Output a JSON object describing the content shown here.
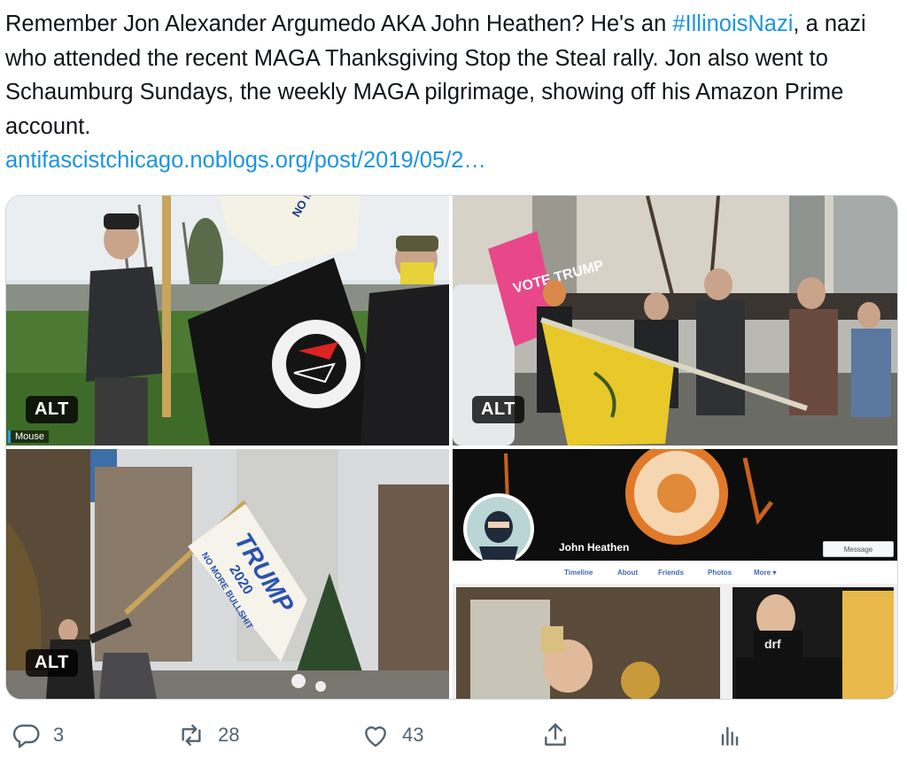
{
  "tweet": {
    "text_part1": "Remember Jon Alexander Argumedo AKA John Heathen? He's an ",
    "hashtag": "#IllinoisNazi",
    "text_part2": ", a nazi who attended the recent MAGA Thanksgiving Stop the Steal rally. Jon also went to Schaumburg Sundays, the weekly MAGA pilgrimage, showing off his Amazon Prime account.",
    "link": "antifascistchicago.noblogs.org/post/2019/05/2…"
  },
  "media": {
    "alt_label": "ALT",
    "photo1_caption": "Mouse",
    "photo1_flag_text": "NO MORE BULLSHIT",
    "photo2_sign_text": "VOTE TRUMP",
    "photo3_flag": {
      "line1": "TRUMP",
      "line2": "2020",
      "line3": "NO MORE BULLSHIT"
    },
    "profile": {
      "name": "John Heathen",
      "message_button": "Message",
      "tabs": [
        "Timeline",
        "About",
        "Friends",
        "Photos",
        "More ▾"
      ]
    }
  },
  "actions": {
    "reply_count": "3",
    "retweet_count": "28",
    "like_count": "43"
  },
  "colors": {
    "link": "#1b95e0",
    "icon": "#536471",
    "text": "#0f1419"
  },
  "icons": [
    "reply-icon",
    "retweet-icon",
    "like-icon",
    "share-icon",
    "analytics-icon"
  ]
}
